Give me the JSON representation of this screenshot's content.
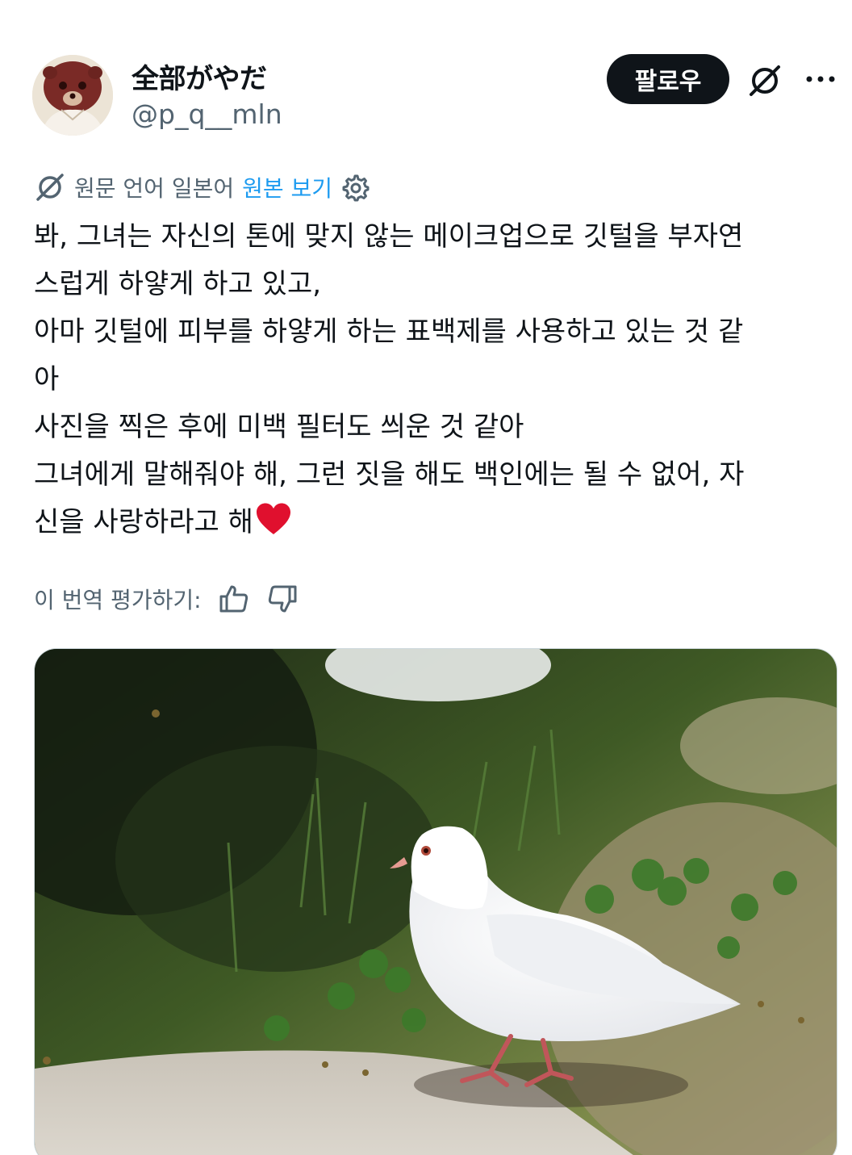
{
  "author": {
    "display_name": "全部がやだ",
    "handle": "@p_q__mln"
  },
  "actions": {
    "follow_label": "팔로우",
    "grok_icon": "grok-slash-icon",
    "more_icon": "more-dots-icon"
  },
  "translation": {
    "source_language_text": "원문 언어 일본어",
    "view_original_label": "원본 보기",
    "settings_icon": "gear-icon"
  },
  "post": {
    "lines": [
      "봐, 그녀는 자신의 톤에 맞지 않는 메이크업으로 깃털을 부자연",
      "스럽게 하얗게 하고 있고,",
      "아마 깃털에 피부를 하얗게 하는 표백제를 사용하고 있는 것 같",
      "아",
      "사진을 찍은 후에 미백 필터도 씌운 것 같아",
      "그녀에게 말해줘야 해, 그런 짓을 해도 백인에는 될 수 없어, 자",
      "신을 사랑하라고 해"
    ],
    "emoji": "heart-icon"
  },
  "rating": {
    "label": "이 번역 평가하기:",
    "thumbs_up_icon": "thumbs-up-icon",
    "thumbs_down_icon": "thumbs-down-icon"
  },
  "media": {
    "image_subject": "white pigeon on grass"
  },
  "colors": {
    "primary_text": "#0f1419",
    "secondary_text": "#536471",
    "link": "#1d9bf0",
    "follow_bg": "#0f1419",
    "heart": "#e0102e"
  }
}
